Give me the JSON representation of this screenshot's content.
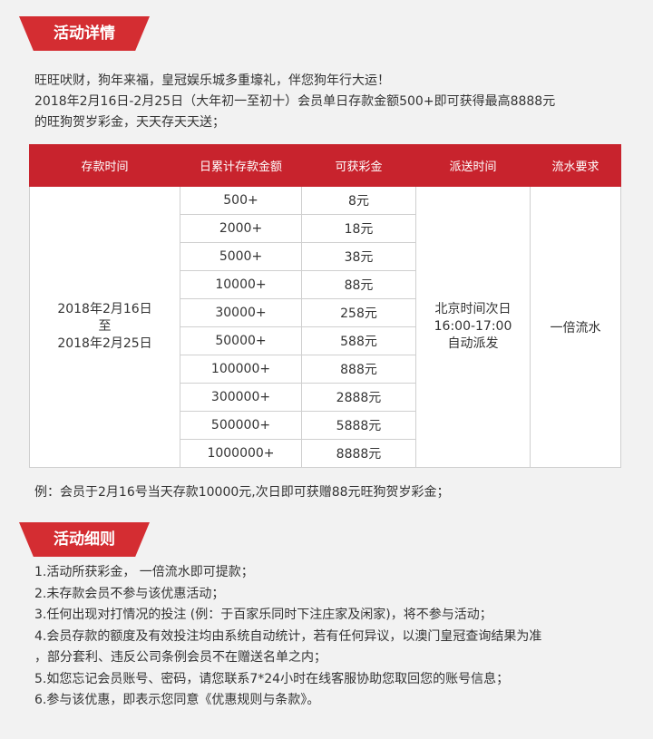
{
  "section1": {
    "title": "活动详情"
  },
  "intro": {
    "line1": "旺旺吠财，狗年来福，皇冠娱乐城多重壕礼，伴您狗年行大运！",
    "line2": "2018年2月16日-2月25日（大年初一至初十）会员单日存款金额500+即可获得最高8888元",
    "line3": "的旺狗贺岁彩金，天天存天天送；"
  },
  "table": {
    "headers": [
      "存款时间",
      "日累计存款金额",
      "可获彩金",
      "派送时间",
      "流水要求"
    ],
    "deposit_period": {
      "start": "2018年2月16日",
      "to": "至",
      "end": "2018年2月25日"
    },
    "rows": [
      {
        "amount": "500+",
        "bonus": "8元"
      },
      {
        "amount": "2000+",
        "bonus": "18元"
      },
      {
        "amount": "5000+",
        "bonus": "38元"
      },
      {
        "amount": "10000+",
        "bonus": "88元"
      },
      {
        "amount": "30000+",
        "bonus": "258元"
      },
      {
        "amount": "50000+",
        "bonus": "588元"
      },
      {
        "amount": "100000+",
        "bonus": "888元"
      },
      {
        "amount": "300000+",
        "bonus": "2888元"
      },
      {
        "amount": "500000+",
        "bonus": "5888元"
      },
      {
        "amount": "1000000+",
        "bonus": "8888元"
      }
    ],
    "delivery": {
      "line1": "北京时间次日",
      "line2": "16:00-17:00",
      "line3": "自动派发"
    },
    "turnover": "一倍流水"
  },
  "example": "例：会员于2月16号当天存款10000元,次日即可获赠88元旺狗贺岁彩金；",
  "section2": {
    "title": "活动细则"
  },
  "rules": [
    "1.活动所获彩金， 一倍流水即可提款；",
    "2.未存款会员不参与该优惠活动；",
    "3.任何出现对打情况的投注 (例：于百家乐同时下注庄家及闲家)，将不参与活动；",
    "4.会员存款的额度及有效投注均由系统自动统计，若有任何异议，以澳门皇冠查询结果为准",
    "，部分套利、违反公司条例会员不在赠送名单之内；",
    "5.如您忘记会员账号、密码，请您联系7*24小时在线客服协助您取回您的账号信息；",
    "6.参与该优惠，即表示您同意《优惠规则与条款》。"
  ],
  "colors": {
    "accent": "#d42d32",
    "header_bg": "#c8232d",
    "page_bg": "#f2f2f2"
  }
}
